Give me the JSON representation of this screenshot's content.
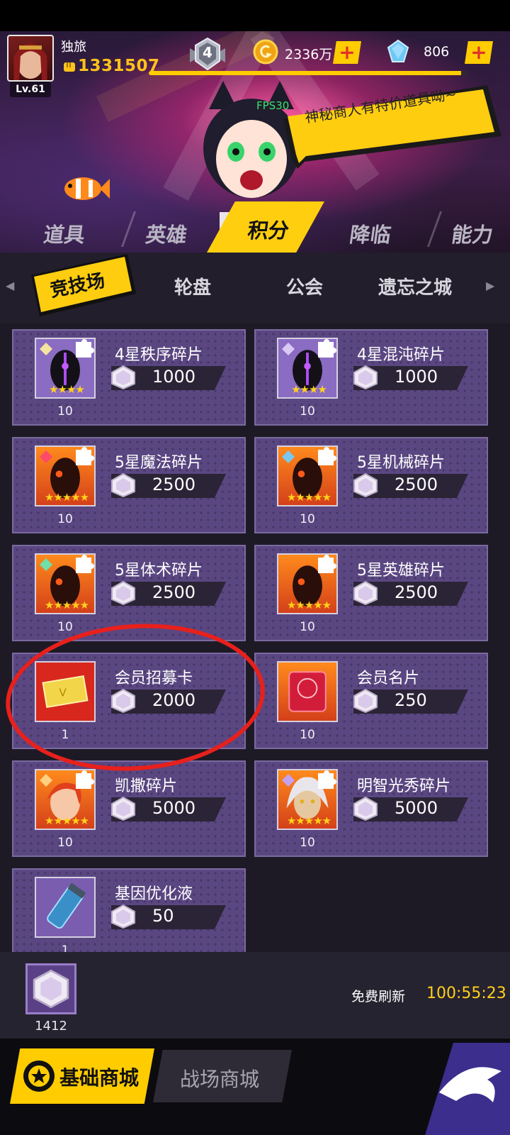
{
  "player": {
    "name": "独旅",
    "level": "Lv.61",
    "power": "1331507",
    "rank": "4",
    "exp_progress": 0.98
  },
  "currency": {
    "gold": "2336万",
    "gems": "806",
    "plus": "+"
  },
  "banner": {
    "fps": "FPS30",
    "speech": "神秘商人有特价道具呦~"
  },
  "category_tabs": [
    "道具",
    "英雄",
    "积分",
    "降临",
    "能力"
  ],
  "active_category": "积分",
  "sub_tabs": {
    "active": "竞技场",
    "others": [
      "轮盘",
      "公会",
      "遗忘之城"
    ]
  },
  "items": [
    {
      "title": "4星秩序碎片",
      "price": "1000",
      "qty": "10",
      "stars": "★★★★"
    },
    {
      "title": "4星混沌碎片",
      "price": "1000",
      "qty": "10",
      "stars": "★★★★"
    },
    {
      "title": "5星魔法碎片",
      "price": "2500",
      "qty": "10",
      "stars": "★★★★★"
    },
    {
      "title": "5星机械碎片",
      "price": "2500",
      "qty": "10",
      "stars": "★★★★★"
    },
    {
      "title": "5星体术碎片",
      "price": "2500",
      "qty": "10",
      "stars": "★★★★★"
    },
    {
      "title": "5星英雄碎片",
      "price": "2500",
      "qty": "10",
      "stars": "★★★★★"
    },
    {
      "title": "会员招募卡",
      "price": "2000",
      "qty": "1",
      "stars": ""
    },
    {
      "title": "会员名片",
      "price": "250",
      "qty": "10",
      "stars": ""
    },
    {
      "title": "凯撒碎片",
      "price": "5000",
      "qty": "10",
      "stars": "★★★★★"
    },
    {
      "title": "明智光秀碎片",
      "price": "5000",
      "qty": "10",
      "stars": "★★★★★"
    },
    {
      "title": "基因优化液",
      "price": "50",
      "qty": "1",
      "stars": ""
    }
  ],
  "footer": {
    "points_balance": "1412",
    "refresh_label": "免费刷新",
    "refresh_timer": "100:55:23",
    "shop_tabs": [
      "基础商城",
      "战场商城"
    ]
  },
  "colors": {
    "accent": "#ffcc00",
    "card": "#5a4782",
    "annotation": "#e8201c"
  }
}
